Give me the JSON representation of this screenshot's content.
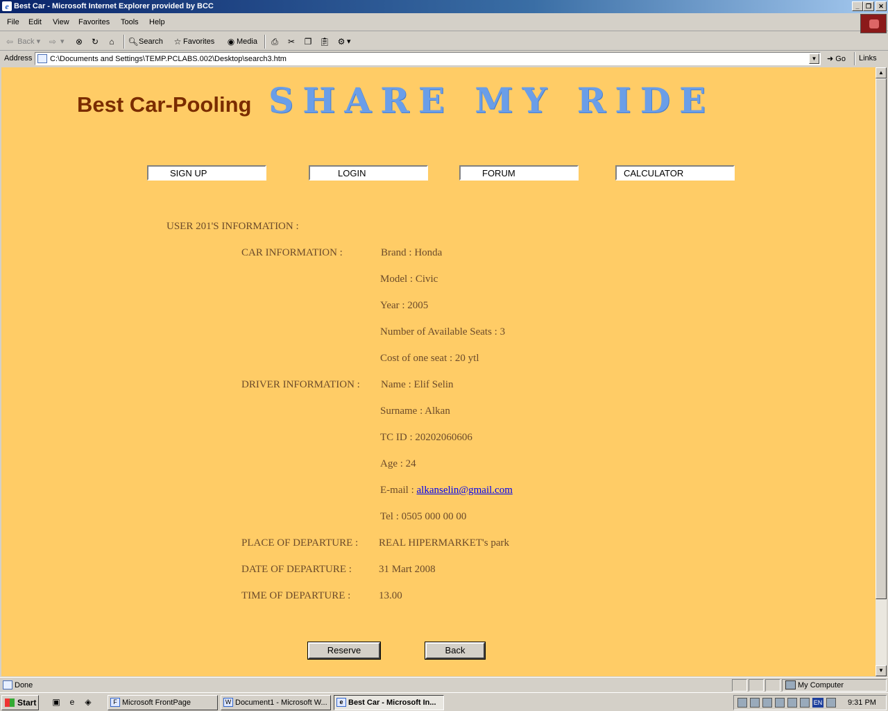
{
  "window": {
    "title": "Best Car - Microsoft Internet Explorer provided by BCC"
  },
  "menu": {
    "items": [
      "File",
      "Edit",
      "View",
      "Favorites",
      "Tools",
      "Help"
    ]
  },
  "toolbar": {
    "back_label": "Back",
    "search_label": "Search",
    "favorites_label": "Favorites",
    "media_label": "Media"
  },
  "address": {
    "label": "Address",
    "url": "C:\\Documents and Settings\\TEMP.PCLABS.002\\Desktop\\search3.htm",
    "go_label": "Go",
    "links_label": "Links"
  },
  "page": {
    "brand": "Best Car-Pooling",
    "tagline": "SHARE MY RIDE",
    "nav": [
      "SIGN UP",
      "LOGIN",
      "FORUM",
      "CALCULATOR"
    ],
    "user_heading": "USER 201'S INFORMATION :",
    "car_label": "CAR INFORMATION :",
    "car": {
      "brand": "Brand : Honda",
      "model": "Model :  Civic",
      "year": "Year : 2005",
      "seats": "Number of Available Seats : 3",
      "cost": "Cost of one seat : 20 ytl"
    },
    "driver_label": "DRIVER INFORMATION :",
    "driver": {
      "name": "Name : Elif Selin",
      "surname": "Surname : Alkan",
      "tc_id": "TC ID : 20202060606",
      "age": "Age : 24",
      "email_label": "E-mail : ",
      "email": "alkanselin@gmail.com",
      "tel": "Tel  : 0505 000 00 00"
    },
    "place_label": "PLACE OF DEPARTURE :",
    "place_value": "REAL HIPERMARKET's park",
    "date_label": "DATE OF DEPARTURE  :",
    "date_value": "31 Mart 2008",
    "time_label": "TIME OF DEPARTURE  :",
    "time_value": "13.00",
    "reserve_label": "Reserve",
    "back_label": "Back",
    "bg_color": "#ffcc66",
    "tagline_color": "#6a9ee8",
    "brand_color": "#7a2c00"
  },
  "status": {
    "text": "Done",
    "zone": "My Computer"
  },
  "taskbar": {
    "start_label": "Start",
    "tasks": [
      "Microsoft FrontPage",
      "Document1 - Microsoft W...",
      "Best Car - Microsoft In..."
    ],
    "lang": "EN",
    "clock": "9:31 PM"
  }
}
